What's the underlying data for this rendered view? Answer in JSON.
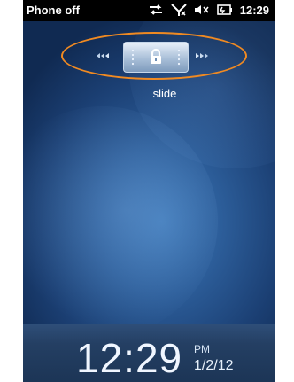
{
  "status_bar": {
    "left_text": "Phone off",
    "time": "12:29",
    "icons": [
      "sync-icon",
      "no-signal-icon",
      "speaker-muted-icon",
      "battery-icon"
    ]
  },
  "lock_slider": {
    "label": "slide",
    "handle_icon": "lock-icon",
    "left_arrows_icon": "rewind-arrows-icon",
    "right_arrows_icon": "forward-arrows-icon",
    "highlight_color": "#f08a22"
  },
  "clock": {
    "time": "12:29",
    "ampm": "PM",
    "date": "1/2/12"
  }
}
